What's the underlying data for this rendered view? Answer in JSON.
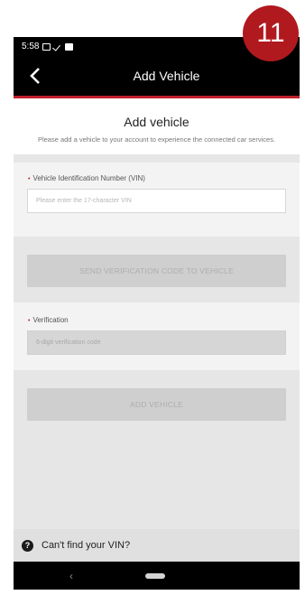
{
  "step": {
    "number": "11"
  },
  "status_bar": {
    "time": "5:58"
  },
  "header": {
    "title": "Add Vehicle",
    "back_icon": "chevron-left-icon"
  },
  "intro": {
    "title": "Add vehicle",
    "description": "Please add a vehicle to your account to experience the connected car services."
  },
  "vin": {
    "required_marker": "•",
    "label": "Vehicle Identification Number (VIN)",
    "placeholder": "Please enter the 17-character VIN"
  },
  "send_code_button": {
    "label": "SEND VERIFICATION CODE TO VEHICLE"
  },
  "verification": {
    "required_marker": "•",
    "label": "Verification",
    "placeholder": "6-digit verification code"
  },
  "add_vehicle_button": {
    "label": "ADD VEHICLE"
  },
  "help": {
    "icon_text": "?",
    "label": "Can't find your VIN?"
  },
  "nav_bar": {
    "back_glyph": "‹"
  },
  "colors": {
    "accent": "#c0202a",
    "badge": "#b0191e",
    "app_bar": "#000000"
  }
}
